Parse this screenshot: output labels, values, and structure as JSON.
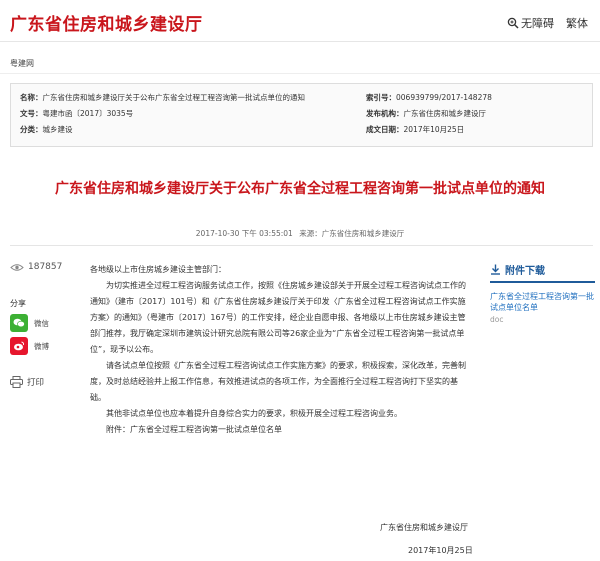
{
  "header": {
    "site_title": "广东省住房和城乡建设厅",
    "accessibility_label": "无障碍",
    "traditional_label": "繁体"
  },
  "breadcrumb": "粤建网",
  "meta": {
    "name_label": "名称：",
    "name_value": "广东省住房和城乡建设厅关于公布广东省全过程工程咨询第一批试点单位的通知",
    "doc_no_label": "文号：",
    "doc_no_value": "粤建市函〔2017〕3035号",
    "category_label": "分类：",
    "category_value": "城乡建设",
    "index_label": "索引号：",
    "index_value": "006939799/2017-148278",
    "issuer_label": "发布机构：",
    "issuer_value": "广东省住房和城乡建设厅",
    "date_label": "成文日期：",
    "date_value": "2017年10月25日"
  },
  "article": {
    "title": "广东省住房和城乡建设厅关于公布广东省全过程工程咨询第一批试点单位的通知",
    "published": "2017-10-30 下午 03:55:01",
    "source": "来源：广东省住房和城乡建设厅",
    "salutation": "各地级以上市住房城乡建设主管部门：",
    "paragraphs": [
      "为切实推进全过程工程咨询服务试点工作，按照《住房城乡建设部关于开展全过程工程咨询试点工作的通知》（建市〔2017〕101号）和《广东省住房城乡建设厅关于印发〈广东省全过程工程咨询试点工作实施方案〉的通知》（粤建市〔2017〕167号）的工作安排，经企业自愿申报、各地级以上市住房城乡建设主管部门推荐，我厅确定深圳市建筑设计研究总院有限公司等26家企业为“广东省全过程工程咨询第一批试点单位”，现予以公布。",
      "请各试点单位按照《广东省全过程工程咨询试点工作实施方案》的要求，积极探索，深化改革，完善制度，及时总结经验并上报工作信息，有效推进试点的各项工作，为全面推行全过程工程咨询打下坚实的基础。",
      "其他非试点单位也应本着提升自身综合实力的要求，积极开展全过程工程咨询业务。",
      "附件：广东省全过程工程咨询第一批试点单位名单"
    ],
    "signature_org": "广东省住房和城乡建设厅",
    "signature_date": "2017年10月25日"
  },
  "sidebar_left": {
    "views": "187857",
    "share_label": "分享",
    "wechat_label": "微信",
    "weibo_label": "微博",
    "print_label": "打印"
  },
  "attachments": {
    "heading": "附件下载",
    "items": [
      {
        "title": "广东省全过程工程咨询第一批试点单位名单",
        "ext": "doc"
      }
    ]
  },
  "colors": {
    "brand_red": "#c9161c",
    "link_blue": "#1f6fbf",
    "wechat_green": "#3cb034",
    "weibo_red": "#e6162d"
  }
}
